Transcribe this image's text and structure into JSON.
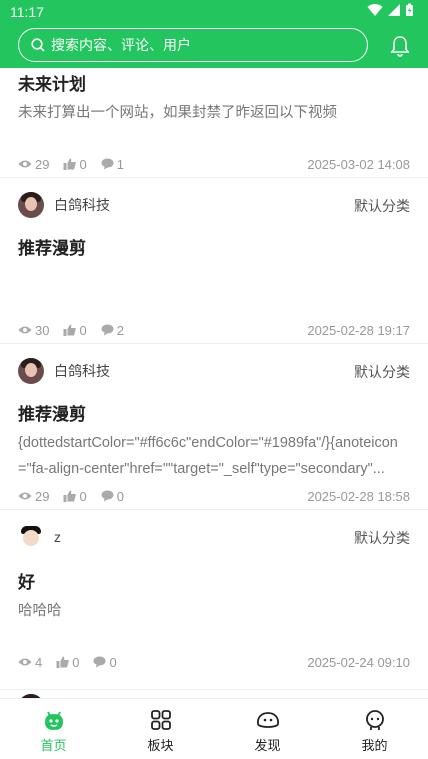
{
  "status_bar": {
    "time": "11:17"
  },
  "search": {
    "placeholder": "搜索内容、评论、用户"
  },
  "posts": [
    {
      "title": "未来计划",
      "body": "未来打算出一个网站，如果封禁了昨返回以下视频",
      "views": "29",
      "likes": "0",
      "comments": "1",
      "date": "2025-03-02 14:08"
    },
    {
      "author": "白鸽科技",
      "category": "默认分类",
      "title": "推荐漫剪",
      "body": "",
      "views": "30",
      "likes": "0",
      "comments": "2",
      "date": "2025-02-28 19:17"
    },
    {
      "author": "白鸽科技",
      "category": "默认分类",
      "title": "推荐漫剪",
      "body": "{dottedstartColor=\"#ff6c6c\"endColor=\"#1989fa\"/}{anoteicon=\"fa-align-center\"href=\"\"target=\"_self\"type=\"secondary\"...",
      "views": "29",
      "likes": "0",
      "comments": "0",
      "date": "2025-02-28 18:58"
    },
    {
      "author": "z",
      "category": "默认分类",
      "title": "好",
      "body": "哈哈哈",
      "views": "4",
      "likes": "0",
      "comments": "0",
      "date": "2025-02-24 09:10"
    }
  ],
  "tabbar": {
    "items": [
      {
        "label": "首页",
        "icon": "home-icon"
      },
      {
        "label": "板块",
        "icon": "grid-icon"
      },
      {
        "label": "发现",
        "icon": "discover-icon"
      },
      {
        "label": "我的",
        "icon": "profile-icon"
      }
    ]
  },
  "colors": {
    "accent": "#22c55e",
    "text": "#222222",
    "muted": "#999999"
  }
}
